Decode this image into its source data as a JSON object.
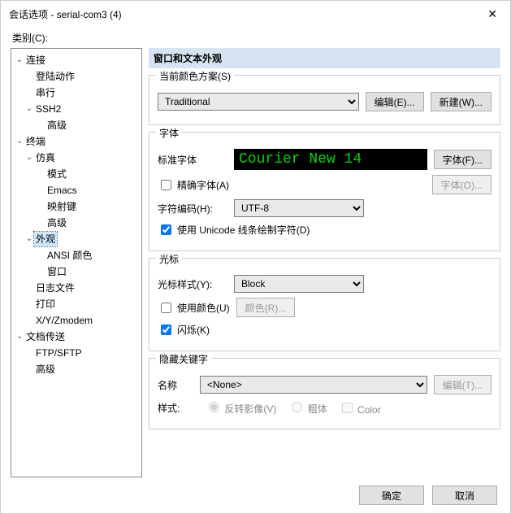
{
  "title": "会话选项 - serial-com3 (4)",
  "category_label": "类别(C):",
  "tree": [
    {
      "label": "连接",
      "exp": "v",
      "ind": 0
    },
    {
      "label": "登陆动作",
      "exp": "",
      "ind": 1
    },
    {
      "label": "串行",
      "exp": "",
      "ind": 1
    },
    {
      "label": "SSH2",
      "exp": "v",
      "ind": 1
    },
    {
      "label": "高级",
      "exp": "",
      "ind": 2
    },
    {
      "label": "终端",
      "exp": "v",
      "ind": 0
    },
    {
      "label": "仿真",
      "exp": "v",
      "ind": 1
    },
    {
      "label": "模式",
      "exp": "",
      "ind": 2
    },
    {
      "label": "Emacs",
      "exp": "",
      "ind": 2
    },
    {
      "label": "映射键",
      "exp": "",
      "ind": 2
    },
    {
      "label": "高级",
      "exp": "",
      "ind": 2
    },
    {
      "label": "外观",
      "exp": "v",
      "ind": 1,
      "selected": true
    },
    {
      "label": "ANSI 颜色",
      "exp": "",
      "ind": 2
    },
    {
      "label": "窗口",
      "exp": "",
      "ind": 2
    },
    {
      "label": "日志文件",
      "exp": "",
      "ind": 1
    },
    {
      "label": "打印",
      "exp": "",
      "ind": 1
    },
    {
      "label": "X/Y/Zmodem",
      "exp": "",
      "ind": 1
    },
    {
      "label": "文档传送",
      "exp": "v",
      "ind": 0
    },
    {
      "label": "FTP/SFTP",
      "exp": "",
      "ind": 1
    },
    {
      "label": "高级",
      "exp": "",
      "ind": 1
    }
  ],
  "header": "窗口和文本外观",
  "scheme": {
    "label": "当前颜色方案(S)",
    "value": "Traditional",
    "edit_btn": "编辑(E)...",
    "new_btn": "新建(W)..."
  },
  "font": {
    "legend": "字体",
    "std_label": "标准字体",
    "preview": "Courier New 14",
    "font_btn": "字体(F)...",
    "precise_chk": "精确字体(A)",
    "precise_checked": false,
    "font_btn2": "字体(O)...",
    "charset_label": "字符编码(H):",
    "charset_value": "UTF-8",
    "unicode_chk": "使用 Unicode 线条绘制字符(D)",
    "unicode_checked": true
  },
  "cursor": {
    "legend": "光标",
    "style_label": "光标样式(Y):",
    "style_value": "Block",
    "color_chk": "使用颜色(U)",
    "color_checked": false,
    "color_btn": "颜色(R)...",
    "blink_chk": "闪烁(K)",
    "blink_checked": true
  },
  "hidekey": {
    "legend": "隐藏关键字",
    "name_label": "名称",
    "name_value": "<None>",
    "edit_btn": "编辑(T)...",
    "style_label": "样式:",
    "radio_reverse": "反转影像(V)",
    "radio_bold": "粗体",
    "radio_color": "Color"
  },
  "footer": {
    "ok": "确定",
    "cancel": "取消"
  }
}
